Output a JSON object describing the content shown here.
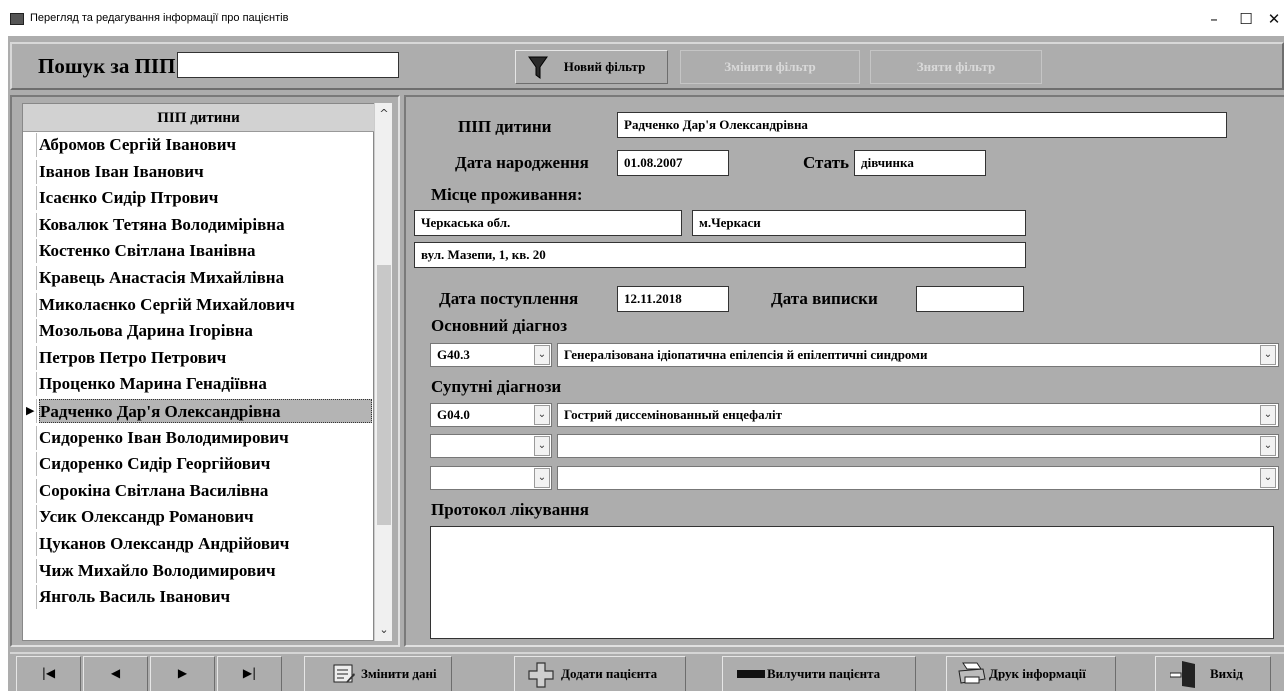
{
  "window": {
    "title": "Перегляд та редагування інформації про пацієнтів",
    "minimize": "–",
    "maximize": "☐",
    "close": "✕"
  },
  "search": {
    "label": "Пошук за ПІП",
    "value": "",
    "new_filter": "Новий фільтр",
    "change_filter": "Змінити фільтр",
    "remove_filter": "Зняти фільтр"
  },
  "list": {
    "header": "ПІП дитини",
    "patients": [
      "Абромов Сергій Іванович",
      "Іванов Іван Іванович",
      "Ісаєнко Сидір Птрович",
      "Ковалюк Тетяна Володимірівна",
      "Костенко Світлана Іванівна",
      "Кравець Анастасія Михайлівна",
      "Миколаєнко Сергій Михайлович",
      "Мозольова Дарина Ігорівна",
      "Петров Петро Петрович",
      "Проценко Марина Генадіївна",
      "Радченко Дар'я Олександрівна",
      "Сидоренко Іван Володимирович",
      "Сидоренко Сидір Георгійович",
      "Сорокіна Світлана Василівна",
      "Усик Олександр Романович",
      "Цуканов Олександр Андрійович",
      "Чиж Михайло Володимирович",
      "Янголь Василь Іванович"
    ],
    "selected_index": 10,
    "scroll_up": "^",
    "scroll_down": "⌄"
  },
  "detail": {
    "name_label": "ПІП дитини",
    "name_value": "Радченко Дар'я Олександрівна",
    "birth_label": "Дата народження",
    "birth_value": "01.08.2007",
    "sex_label": "Стать",
    "sex_value": "дівчинка",
    "residence_label": "Місце проживання:",
    "region_value": "Черкаська обл.",
    "city_value": "м.Черкаси",
    "street_value": "вул. Мазепи, 1, кв. 20",
    "admission_label": "Дата поступлення",
    "admission_value": "12.11.2018",
    "discharge_label": "Дата виписки",
    "discharge_value": "",
    "main_dx_label": "Основний діагноз",
    "main_dx_code": "G40.3",
    "main_dx_text": "Генералізована ідіопатична епілепсія й епілептичні синдроми",
    "comorbid_label": "Супутні діагнози",
    "comorbid": [
      {
        "code": "G04.0",
        "text": "Гострий диссемінованный енцефаліт"
      },
      {
        "code": "",
        "text": ""
      },
      {
        "code": "",
        "text": ""
      }
    ],
    "protocol_label": "Протокол лікування",
    "protocol_value": "",
    "dropdown_glyph": "⌄"
  },
  "bottom": {
    "nav_first": "|◀",
    "nav_prev": "◀",
    "nav_next": "▶",
    "nav_last": "▶|",
    "edit": "Змінити дані",
    "add": "Додати пацієнта",
    "remove": "Вилучити пацієнта",
    "print": "Друк інформації",
    "exit": "Вихід"
  },
  "icons": {
    "app": "app-icon",
    "filter": "funnel-icon",
    "edit": "edit-form-icon",
    "add": "plus-icon",
    "remove": "minus-icon",
    "print": "printer-icon",
    "exit": "door-exit-icon"
  },
  "colors": {
    "panel": "#adadad",
    "field": "#ffffff",
    "selected_row": "#b4b4b4",
    "disabled_text": "#d9d9d9"
  }
}
